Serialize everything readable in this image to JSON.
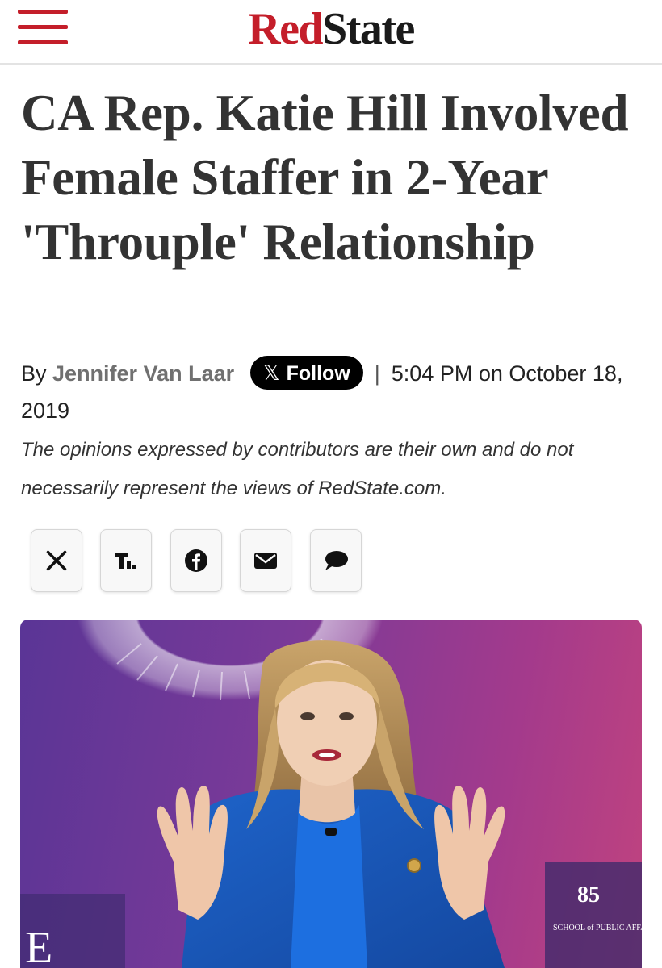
{
  "header": {
    "logo_red": "Red",
    "logo_black": "State",
    "menu_icon": "hamburger-menu-icon"
  },
  "article": {
    "headline": "CA Rep. Katie Hill Involved Female Staffer in 2-Year 'Throuple' Relationship",
    "byline_prefix": "By",
    "author": "Jennifer Van Laar",
    "follow_label": "Follow",
    "separator": "|",
    "timestamp": "5:04 PM on October 18, 2019",
    "disclaimer": "The opinions expressed by contributors are their own and do not necessarily represent the views of RedState.com."
  },
  "share_buttons": [
    {
      "icon": "x-icon"
    },
    {
      "icon": "townhall-icon"
    },
    {
      "icon": "facebook-icon"
    },
    {
      "icon": "email-icon"
    },
    {
      "icon": "comment-icon"
    }
  ],
  "hero_image": {
    "banner_text": "SCHOOL of PUBLIC AFFAIRS",
    "banner_number": "85",
    "left_letter": "E"
  },
  "colors": {
    "brand_red": "#c41e2a",
    "headline": "#333333",
    "author_gray": "#707070",
    "follow_bg": "#000000"
  }
}
